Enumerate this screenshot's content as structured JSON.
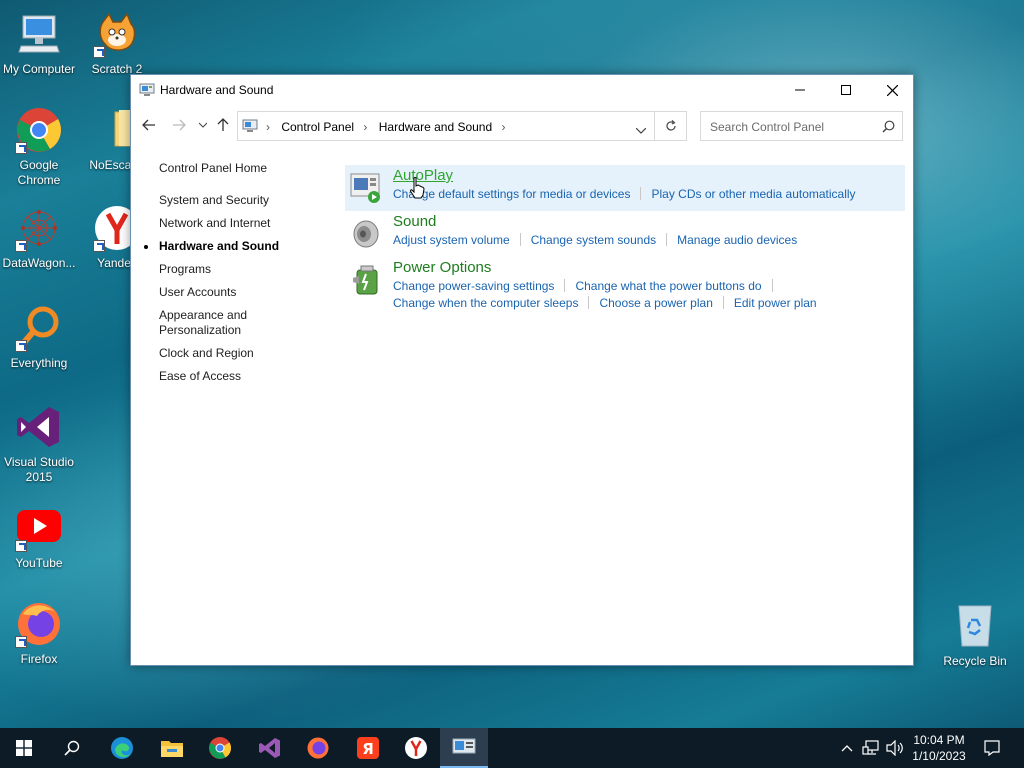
{
  "desktop": {
    "icons": [
      {
        "label": "My Computer"
      },
      {
        "label": "Scratch 2"
      },
      {
        "label": "Google Chrome"
      },
      {
        "label": "NoEscape"
      },
      {
        "label": "DataWagon..."
      },
      {
        "label": "Yandex"
      },
      {
        "label": "Everything"
      },
      {
        "label": "Visual Studio 2015"
      },
      {
        "label": "YouTube"
      },
      {
        "label": "Firefox"
      },
      {
        "label": "Recycle Bin"
      }
    ]
  },
  "window": {
    "title": "Hardware and Sound",
    "breadcrumb": [
      "Control Panel",
      "Hardware and Sound"
    ],
    "search_placeholder": "Search Control Panel"
  },
  "leftnav": {
    "home": "Control Panel Home",
    "items": [
      {
        "label": "System and Security"
      },
      {
        "label": "Network and Internet"
      },
      {
        "label": "Hardware and Sound",
        "active": true
      },
      {
        "label": "Programs"
      },
      {
        "label": "User Accounts"
      },
      {
        "label": "Appearance and Personalization"
      },
      {
        "label": "Clock and Region"
      },
      {
        "label": "Ease of Access"
      }
    ]
  },
  "categories": [
    {
      "title": "AutoPlay",
      "links": [
        "Change default settings for media or devices",
        "Play CDs or other media automatically"
      ],
      "links2": []
    },
    {
      "title": "Sound",
      "links": [
        "Adjust system volume",
        "Change system sounds",
        "Manage audio devices"
      ],
      "links2": []
    },
    {
      "title": "Power Options",
      "links": [
        "Change power-saving settings",
        "Change what the power buttons do"
      ],
      "links2": [
        "Change when the computer sleeps",
        "Choose a power plan",
        "Edit power plan"
      ]
    }
  ],
  "taskbar": {
    "time": "10:04 PM",
    "date": "1/10/2023"
  },
  "colors": {
    "link": "#1a64b0",
    "category_title": "#1e7d1e",
    "taskbar": "#0c1b26"
  }
}
